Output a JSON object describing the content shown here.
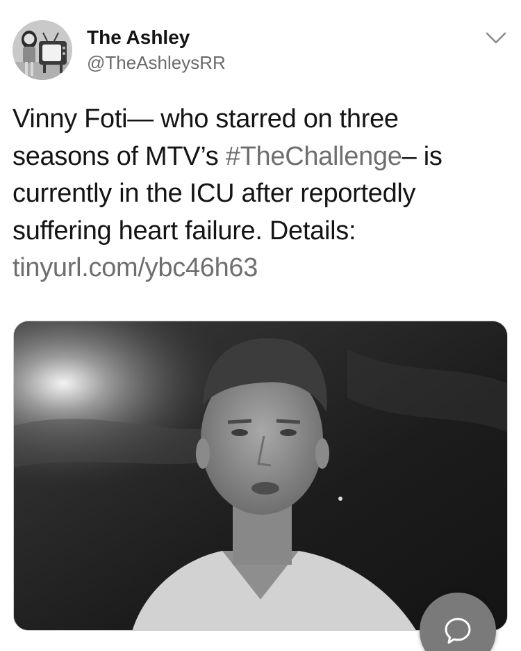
{
  "tweet": {
    "author_name": "The Ashley",
    "author_handle": "@TheAshleysRR",
    "text_lines": [
      {
        "a": "Vinny Foti— who starred on three",
        "h": "",
        "b": ""
      },
      {
        "a": "seasons of MTV’s ",
        "h": "#TheChallenge",
        "b": "– is"
      },
      {
        "a": "currently in the ICU after reportedly",
        "h": "",
        "b": ""
      },
      {
        "a": "suffering heart failure. Details:",
        "h": "",
        "b": ""
      }
    ],
    "link": "tinyurl.com/ybc46h63"
  },
  "icons": {
    "menu": "chevron-down-icon",
    "reply": "speech-bubble-icon",
    "avatar": "tv-avatar-icon"
  },
  "colors": {
    "text": "#141414",
    "secondary": "#6b6b6b",
    "fab": "#7a7a7a"
  }
}
